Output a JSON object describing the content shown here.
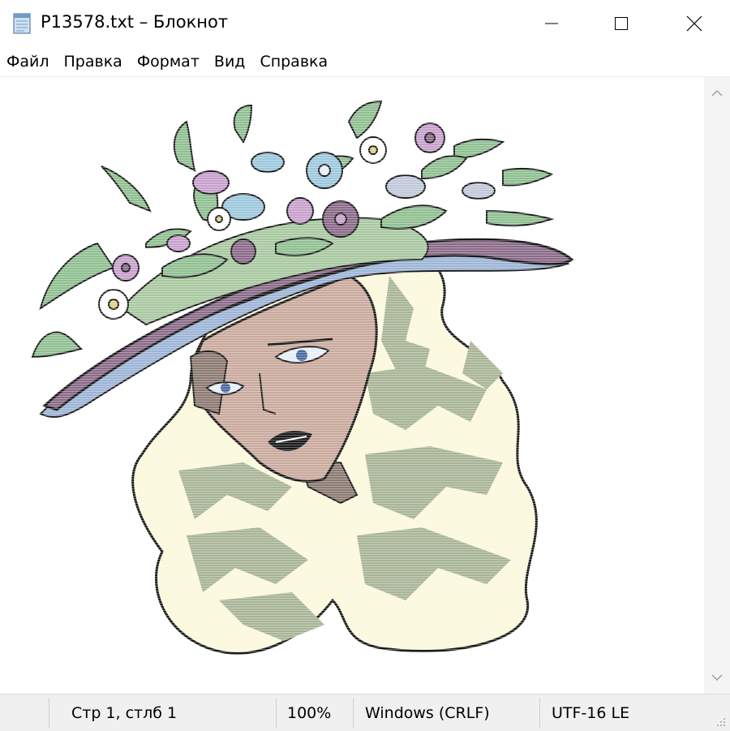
{
  "window": {
    "title": "P13578.txt – Блокнот",
    "icons": [
      "notepad-app-icon",
      "minimize-icon",
      "maximize-icon",
      "close-icon"
    ]
  },
  "menu": {
    "items": [
      {
        "label": "Файл"
      },
      {
        "label": "Правка"
      },
      {
        "label": "Формат"
      },
      {
        "label": "Вид"
      },
      {
        "label": "Справка"
      }
    ]
  },
  "document": {
    "content_description_icon": "woman-with-flower-hat-ascii-art"
  },
  "statusbar": {
    "position": "Стр 1, стлб 1",
    "zoom": "100%",
    "line_ending": "Windows (CRLF)",
    "encoding": "UTF-16 LE"
  },
  "colors": {
    "hat_brim": "#8a6a88",
    "hat_under": "#9cb4d6",
    "leaves": "#8fbf90",
    "flowers_purple": "#c8a0cc",
    "flowers_blue": "#9cc8dc",
    "skin": "#c9a99c",
    "hair_light": "#fbf8dc",
    "hair_shadow": "#a8b496",
    "outline": "#1a1a1a"
  }
}
